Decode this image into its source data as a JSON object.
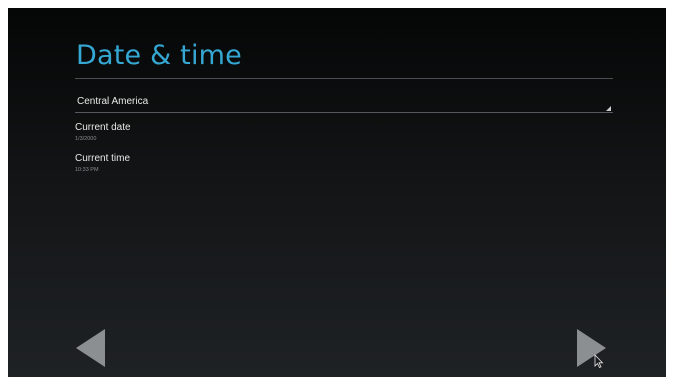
{
  "header": {
    "title": "Date & time"
  },
  "timezone": {
    "selected": "Central America"
  },
  "settings": {
    "date": {
      "title": "Current date",
      "value": "1/3/2000"
    },
    "time": {
      "title": "Current time",
      "value": "10:33 PM"
    }
  },
  "navigation": {
    "back_icon": "triangle-left-icon",
    "next_icon": "triangle-right-icon"
  },
  "colors": {
    "accent": "#35a7d3",
    "nav_arrow": "#8c8f91"
  }
}
